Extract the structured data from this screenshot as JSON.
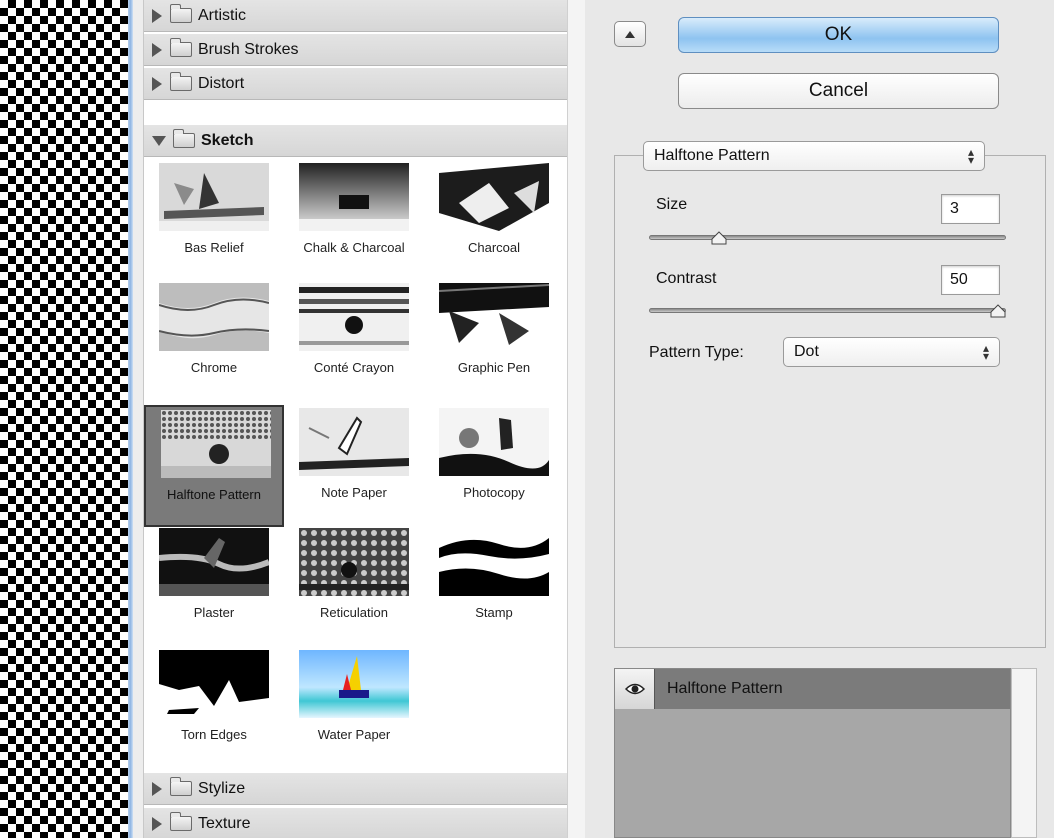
{
  "categories_top": [
    {
      "label": "Artistic",
      "expanded": false
    },
    {
      "label": "Brush Strokes",
      "expanded": false
    },
    {
      "label": "Distort",
      "expanded": false
    },
    {
      "label": "Sketch",
      "expanded": true
    }
  ],
  "categories_bottom": [
    {
      "label": "Stylize",
      "expanded": false
    },
    {
      "label": "Texture",
      "expanded": false
    }
  ],
  "sketch_filters": [
    {
      "label": "Bas Relief"
    },
    {
      "label": "Chalk & Charcoal"
    },
    {
      "label": "Charcoal"
    },
    {
      "label": "Chrome"
    },
    {
      "label": "Conté Crayon"
    },
    {
      "label": "Graphic Pen"
    },
    {
      "label": "Halftone Pattern",
      "selected": true
    },
    {
      "label": "Note Paper"
    },
    {
      "label": "Photocopy"
    },
    {
      "label": "Plaster"
    },
    {
      "label": "Reticulation"
    },
    {
      "label": "Stamp"
    },
    {
      "label": "Torn Edges"
    },
    {
      "label": "Water Paper"
    }
  ],
  "buttons": {
    "ok": "OK",
    "cancel": "Cancel"
  },
  "settings": {
    "filter_select": "Halftone Pattern",
    "size": {
      "label": "Size",
      "value": "3",
      "min": 1,
      "max": 12
    },
    "contrast": {
      "label": "Contrast",
      "value": "50",
      "min": 0,
      "max": 50
    },
    "pattern_type": {
      "label": "Pattern Type:",
      "value": "Dot"
    }
  },
  "effect_layers": [
    {
      "name": "Halftone Pattern",
      "visible_icon": "eye-icon"
    }
  ],
  "colors": {
    "ok_button": "#8ec3f0",
    "selection": "#7a7a7a"
  }
}
